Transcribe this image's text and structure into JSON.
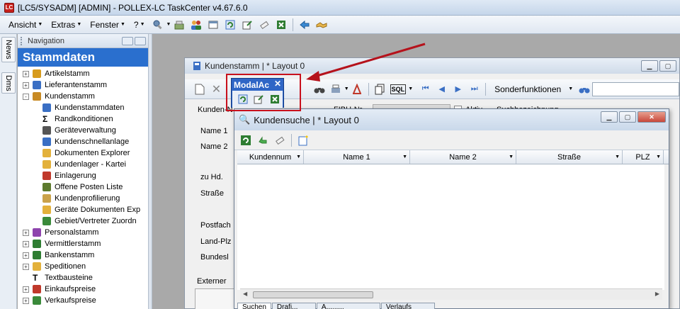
{
  "titlebar": {
    "title": "[LC5/SYSADM] [ADMIN] - POLLEX-LC TaskCenter v4.67.6.0",
    "app_icon_text": "LC"
  },
  "menubar": {
    "items": [
      {
        "label": "Ansicht",
        "has_dropdown": true
      },
      {
        "label": "Extras",
        "has_dropdown": true
      },
      {
        "label": "Fenster",
        "has_dropdown": true
      },
      {
        "label": "?",
        "has_dropdown": true
      }
    ],
    "toolbar_icons": [
      "tools-icon",
      "cash-register-icon",
      "users-icon",
      "window-icon",
      "refresh-window-icon",
      "export-icon",
      "eraser-icon",
      "excel-icon",
      "back-arrow-icon",
      "handshake-icon"
    ]
  },
  "side_tabs": {
    "news": "News",
    "dms": "Dms"
  },
  "navigation": {
    "header": "Navigation",
    "section": "Stammdaten",
    "items": [
      {
        "label": "Artikelstamm",
        "level": 0,
        "expander": "+",
        "icon": "box-icon",
        "color": "#d79b1c"
      },
      {
        "label": "Lieferantenstamm",
        "level": 0,
        "expander": "+",
        "icon": "supplier-icon",
        "color": "#3a6fc4"
      },
      {
        "label": "Kundenstamm",
        "level": 0,
        "expander": "-",
        "icon": "customer-icon",
        "color": "#c88a24"
      },
      {
        "label": "Kundenstammdaten",
        "level": 1,
        "icon": "customer-data-icon",
        "color": "#3a6fc4"
      },
      {
        "label": "Randkonditionen",
        "level": 1,
        "icon": "sigma-icon",
        "color": "#000000"
      },
      {
        "label": "Geräteverwaltung",
        "level": 1,
        "icon": "device-icon",
        "color": "#555555"
      },
      {
        "label": "Kundenschnellanlage",
        "level": 1,
        "icon": "quick-add-icon",
        "color": "#3a6fc4"
      },
      {
        "label": "Dokumenten Explorer",
        "level": 1,
        "icon": "folder-icon",
        "color": "#e3b13b"
      },
      {
        "label": "Kundenlager - Kartei",
        "level": 1,
        "icon": "folder-icon",
        "color": "#e3b13b"
      },
      {
        "label": "Einlagerung",
        "level": 1,
        "icon": "storage-icon",
        "color": "#c0392b"
      },
      {
        "label": "Offene Posten Liste",
        "level": 1,
        "icon": "money-bag-icon",
        "color": "#5d7a2d"
      },
      {
        "label": "Kundenprofilierung",
        "level": 1,
        "icon": "handshake-icon",
        "color": "#caa24a"
      },
      {
        "label": "Geräte Dokumenten Exp",
        "level": 1,
        "icon": "folder-icon",
        "color": "#e3b13b"
      },
      {
        "label": "Gebiet/Vertreter Zuordn",
        "level": 1,
        "icon": "map-icon",
        "color": "#3a8a3a"
      },
      {
        "label": "Personalstamm",
        "level": 0,
        "expander": "+",
        "icon": "personnel-icon",
        "color": "#8e44ad"
      },
      {
        "label": "Vermittlerstamm",
        "level": 0,
        "expander": "+",
        "icon": "broker-icon",
        "color": "#2e7d32"
      },
      {
        "label": "Bankenstamm",
        "level": 0,
        "expander": "+",
        "icon": "bank-icon",
        "color": "#2e7d32"
      },
      {
        "label": "Speditionen",
        "level": 0,
        "expander": "+",
        "icon": "globe-icon",
        "color": "#e3b13b"
      },
      {
        "label": "Textbausteine",
        "level": 0,
        "expander": "",
        "icon": "text-icon",
        "color": "#000000"
      },
      {
        "label": "Einkaufspreise",
        "level": 0,
        "expander": "+",
        "icon": "price-list-icon",
        "color": "#c0392b"
      },
      {
        "label": "Verkaufspreise",
        "level": 0,
        "expander": "+",
        "icon": "price-list-icon",
        "color": "#3a8a3a"
      }
    ]
  },
  "kundenstamm_window": {
    "title": "Kundenstamm | * Layout 0",
    "toolbar": {
      "sql_label": "SQL",
      "sonderfunktionen": "Sonderfunktionen"
    },
    "labels": {
      "kunden_nr": "Kunden-N",
      "fibu_nr": "FIBU-Nr.",
      "aktiv": "Aktiv",
      "suchbezeichnung": "Suchbezeichnung",
      "name1": "Name 1",
      "name2": "Name 2",
      "zu_hd": "zu Hd.",
      "strasse": "Straße",
      "postfach": "Postfach",
      "land_plz": "Land-Plz",
      "bundesland": "Bundesl",
      "externer": "Externer"
    }
  },
  "modal_popup": {
    "title": "ModalAc",
    "close": "✕",
    "icons": [
      "refresh-window-icon",
      "export-icon",
      "excel-icon"
    ]
  },
  "kundensuche_window": {
    "title": "Kundensuche | * Layout 0",
    "toolbar_icons": [
      "refresh-icon",
      "back-arrow-icon",
      "eraser-icon",
      "new-icon"
    ],
    "columns": [
      "Kundennum",
      "Name 1",
      "Name 2",
      "Straße",
      "PLZ"
    ],
    "bottom_tabs": [
      "Suchen",
      "Drafi...",
      "A.........",
      "Verlaufs"
    ]
  },
  "colors": {
    "section_blue": "#2a6fce",
    "highlight_red": "#c8101c",
    "popup_blue": "#2f66c6"
  }
}
